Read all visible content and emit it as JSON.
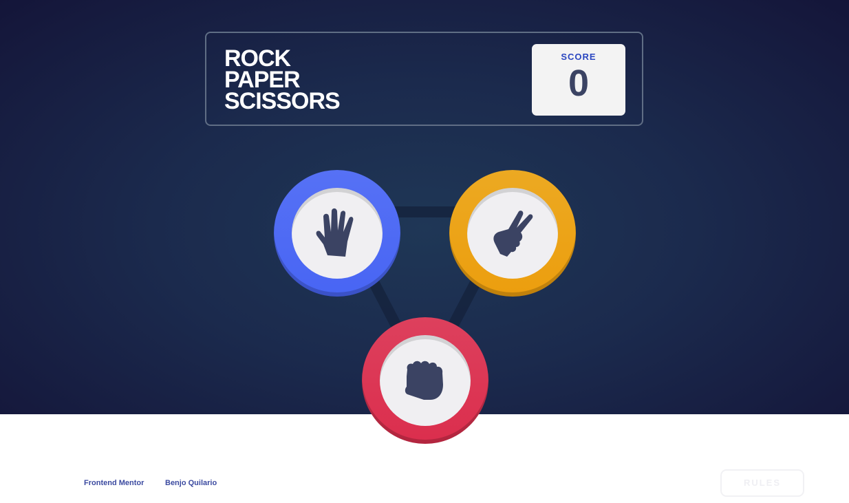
{
  "header": {
    "title_lines": [
      "ROCK",
      "PAPER",
      "SCISSORS"
    ],
    "score_label": "SCORE",
    "score_value": "0"
  },
  "tokens": {
    "paper": {
      "icon": "paper-hand-icon",
      "color": "#4865f4"
    },
    "scissors": {
      "icon": "scissors-hand-icon",
      "color": "#ec9e0e"
    },
    "rock": {
      "icon": "rock-fist-icon",
      "color": "#db2e4d"
    }
  },
  "footer": {
    "link1": "Frontend Mentor",
    "link2": "Benjo Quilario",
    "rules_label": "RULES"
  },
  "colors": {
    "background_dark": "#141539",
    "background_mid": "#1f3756",
    "score_text": "#2a46c0",
    "dark_text": "#3b4363"
  }
}
